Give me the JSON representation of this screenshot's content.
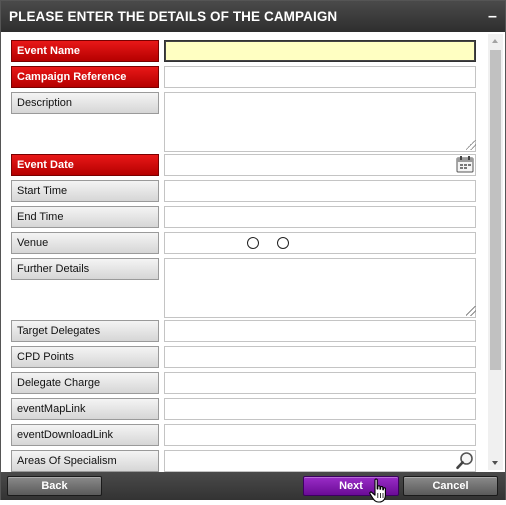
{
  "dialog": {
    "title": "PLEASE ENTER THE DETAILS OF THE CAMPAIGN",
    "minimize_glyph": "–"
  },
  "fields": {
    "event_name": {
      "label": "Event Name",
      "value": "",
      "required": true
    },
    "campaign_reference": {
      "label": "Campaign Reference",
      "value": "",
      "required": true
    },
    "description": {
      "label": "Description",
      "value": ""
    },
    "event_date": {
      "label": "Event Date",
      "value": "",
      "required": true,
      "icon": "calendar-icon"
    },
    "start_time": {
      "label": "Start Time",
      "value": ""
    },
    "end_time": {
      "label": "End Time",
      "value": ""
    },
    "venue": {
      "label": "Venue",
      "value": ""
    },
    "further_details": {
      "label": "Further Details",
      "value": ""
    },
    "target_delegates": {
      "label": "Target Delegates",
      "value": ""
    },
    "cpd_points": {
      "label": "CPD Points",
      "value": ""
    },
    "delegate_charge": {
      "label": "Delegate Charge",
      "value": ""
    },
    "event_map_link": {
      "label": "eventMapLink",
      "value": ""
    },
    "event_download_link": {
      "label": "eventDownloadLink",
      "value": ""
    },
    "areas_of_specialism": {
      "label": "Areas Of Specialism",
      "value": "",
      "icon": "magnifier-icon"
    }
  },
  "footer": {
    "back_label": "Back",
    "next_label": "Next",
    "cancel_label": "Cancel"
  },
  "colors": {
    "required_label": "#c80000",
    "title_bar": "#3a3a3a",
    "next_button": "#7a16a8",
    "active_field": "#ffffc2"
  }
}
